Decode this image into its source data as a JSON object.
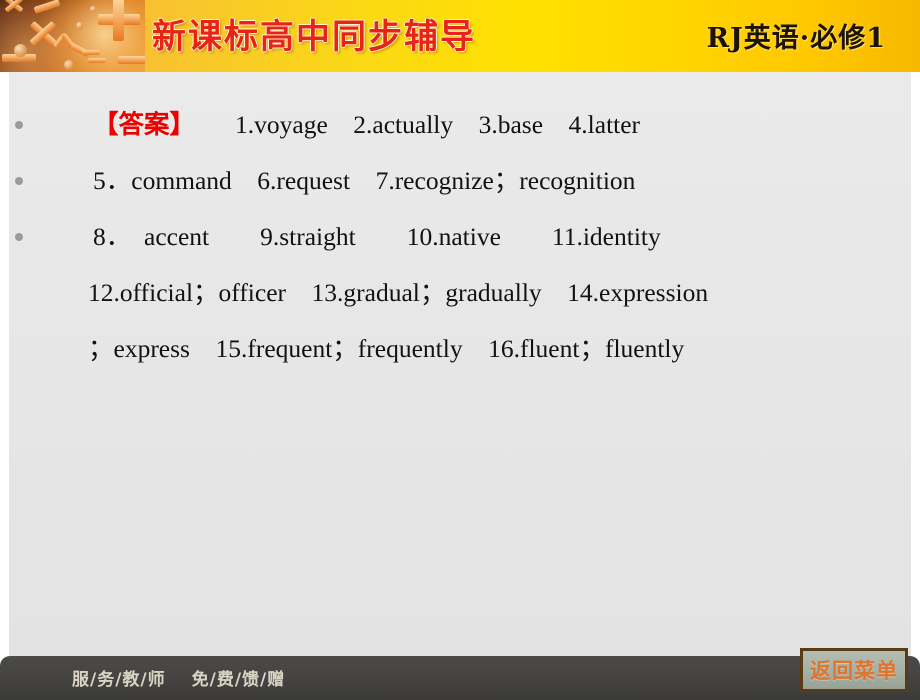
{
  "header": {
    "title": "新课标高中同步辅导",
    "subject": "RJ英语·必修1",
    "artwork_name": "math-symbols-artwork",
    "accent_red": "#e8231a",
    "band_yellow": "#ffe000"
  },
  "content": {
    "answer_tag": "【答案】",
    "lines": [
      {
        "bullet": true,
        "tag": "【答案】",
        "text": "1.voyage　2.actually　3.base　4.latter"
      },
      {
        "bullet": true,
        "text": "5．command　6.request　7.recognize；recognition"
      },
      {
        "bullet": true,
        "text": "8．　accent　　9.straight　　10.native　　11.identity"
      },
      {
        "bullet": false,
        "text": "12.official；officer　13.gradual；gradually　14.expression"
      },
      {
        "bullet": false,
        "text": "；express　15.frequent；frequently　16.fluent；fluently"
      }
    ],
    "items": [
      "1.voyage",
      "2.actually",
      "3.base",
      "4.latter",
      "5．command",
      "6.request",
      "7.recognize；recognition",
      "8．accent",
      "9.straight",
      "10.native",
      "11.identity",
      "12.official；officer",
      "13.gradual；gradually",
      "14.expression；express",
      "15.frequent；frequently",
      "16.fluent；fluently"
    ]
  },
  "footer": {
    "slogan_left": "服/务/教/师",
    "slogan_right": "免/费/馈/赠",
    "menu_button": "返回菜单",
    "menu_button_color": "#e2732a",
    "bar_color": "#454442"
  }
}
